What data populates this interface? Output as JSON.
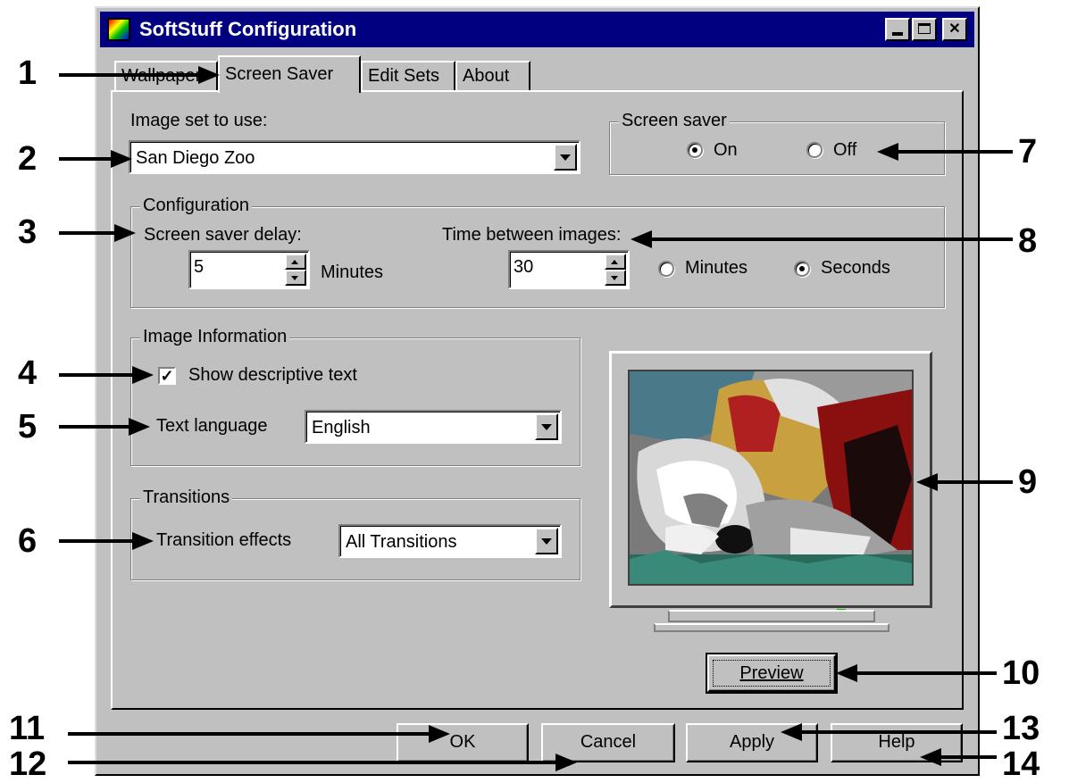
{
  "window": {
    "title": "SoftStuff Configuration"
  },
  "tabs": [
    {
      "label": "Wallpaper"
    },
    {
      "label": "Screen Saver"
    },
    {
      "label": "Edit Sets"
    },
    {
      "label": "About"
    }
  ],
  "image_set": {
    "label": "Image set to use:",
    "value": "San Diego Zoo"
  },
  "screen_saver": {
    "group_title": "Screen saver",
    "on_label": "On",
    "off_label": "Off",
    "selected": "On"
  },
  "configuration": {
    "group_title": "Configuration",
    "delay_label": "Screen saver delay:",
    "delay_value": "5",
    "delay_unit": "Minutes",
    "between_label": "Time between images:",
    "between_value": "30",
    "minutes_label": "Minutes",
    "seconds_label": "Seconds",
    "selected_unit": "Seconds"
  },
  "image_information": {
    "group_title": "Image Information",
    "show_text_label": "Show descriptive text",
    "show_text_checked": true,
    "check_mark": "✓",
    "language_label": "Text language",
    "language_value": "English"
  },
  "transitions": {
    "group_title": "Transitions",
    "effects_label": "Transition effects",
    "effects_value": "All Transitions"
  },
  "preview": {
    "button_label": "Preview"
  },
  "footer": {
    "ok_label": "OK",
    "cancel_label": "Cancel",
    "apply_label": "Apply",
    "help_label": "Help"
  },
  "callouts": [
    "1",
    "2",
    "3",
    "4",
    "5",
    "6",
    "7",
    "8",
    "9",
    "10",
    "11",
    "12",
    "13",
    "14"
  ]
}
